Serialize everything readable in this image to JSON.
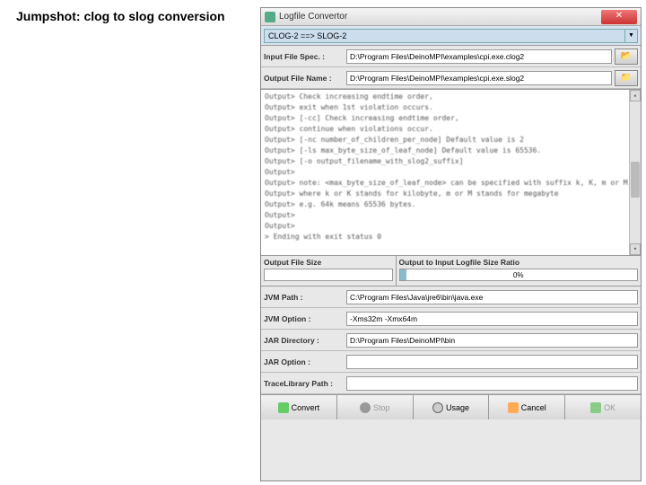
{
  "page_title": "Jumpshot: clog to slog conversion",
  "titlebar": {
    "title": "Logfile Convertor"
  },
  "combo": {
    "value": "CLOG-2  ==>  SLOG-2"
  },
  "input_file": {
    "label": "Input File Spec. :",
    "value": "D:\\Program Files\\DeinoMPI\\examples\\cpi.exe.clog2"
  },
  "output_file": {
    "label": "Output File Name :",
    "value": "D:\\Program Files\\DeinoMPI\\examples\\cpi.exe.slog2"
  },
  "output_lines": [
    "Output>                                  Check increasing endtime order,",
    "Output>                                  exit when 1st violation occurs.",
    "Output>        [-cc]                     Check increasing endtime order,",
    "Output>                                  continue when violations occur.",
    "Output>        [-nc number_of_children_per_node]       Default value is 2",
    "Output>        [-ls max_byte_size_of_leaf_node]         Default value is 65536.",
    "Output>        [-o output_filename_with_slog2_suffix]",
    "Output>",
    "Output> note: <max_byte_size_of_leaf_node> can be specified with suffix k, K, m or M,",
    "Output>       where k or K stands for kilobyte, m or M stands for megabyte",
    "Output>       e.g. 64k means 65536 bytes.",
    "Output>",
    "Output>",
    ">    Ending with exit status 0"
  ],
  "stats": {
    "size_label": "Output File Size",
    "ratio_label": "Output to Input Logfile Size Ratio",
    "ratio_value": "0%"
  },
  "jvm_path": {
    "label": "JVM Path :",
    "value": "C:\\Program Files\\Java\\jre6\\bin\\java.exe"
  },
  "jvm_option": {
    "label": "JVM Option :",
    "value": "-Xms32m -Xmx64m"
  },
  "jar_dir": {
    "label": "JAR Directory :",
    "value": "D:\\Program Files\\DeinoMPI\\bin"
  },
  "jar_option": {
    "label": "JAR Option :",
    "value": ""
  },
  "trace_lib": {
    "label": "TraceLibrary Path :",
    "value": ""
  },
  "buttons": {
    "convert": "Convert",
    "stop": "Stop",
    "usage": "Usage",
    "cancel": "Cancel",
    "ok": "OK"
  }
}
